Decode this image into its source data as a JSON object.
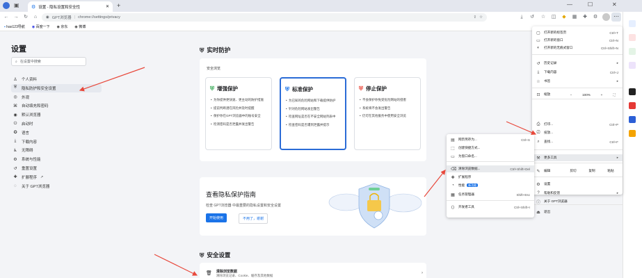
{
  "browser": {
    "tab_title": "设置 - 隐私设置和安全性",
    "new_tab": "+",
    "url_prefix": "GPT浏览器",
    "url": "chrome://settings/privacy",
    "win_min": "—",
    "win_max": "☐",
    "win_close": "✕",
    "bookmarks": [
      "hao123导航",
      "百度一下",
      "京东",
      "微博"
    ]
  },
  "sidebar": {
    "title": "设置",
    "search_placeholder": "在设置中搜索",
    "items": [
      {
        "icon": "person-icon",
        "glyph": "♙",
        "label": "个人资料"
      },
      {
        "icon": "shield-icon",
        "glyph": "⛨",
        "label": "隐私防护和安全设置"
      },
      {
        "icon": "palette-icon",
        "glyph": "◎",
        "label": "外观"
      },
      {
        "icon": "autofill-icon",
        "glyph": "⌘",
        "label": "自动填充和密码"
      },
      {
        "icon": "browser-icon",
        "glyph": "◉",
        "label": "默认浏览器"
      },
      {
        "icon": "power-icon",
        "glyph": "⏻",
        "label": "启动时"
      },
      {
        "icon": "language-icon",
        "glyph": "✪",
        "label": "语言"
      },
      {
        "icon": "download-icon",
        "glyph": "⤓",
        "label": "下载内容"
      },
      {
        "icon": "accessibility-icon",
        "glyph": "♿",
        "label": "无障碍"
      },
      {
        "icon": "system-icon",
        "glyph": "⚙",
        "label": "系统与性能"
      },
      {
        "icon": "reset-icon",
        "glyph": "↺",
        "label": "重置设置"
      },
      {
        "icon": "extension-icon",
        "glyph": "✚",
        "label": "扩展程序"
      },
      {
        "icon": "about-icon",
        "glyph": "◌",
        "label": "关于 GPT浏览器"
      }
    ]
  },
  "safe_browsing": {
    "section_title": "实时防护",
    "subtitle": "安全浏览",
    "options": [
      {
        "title": "增强保护",
        "color": "#34a853",
        "bullets": [
          "为你提供更快速、更主动的防护措施",
          "提前判断潜在风险并及时提醒",
          "保护你在GPT浏览器中的账号安全",
          "检测密码是否泄露并发出警告"
        ]
      },
      {
        "title": "标准保护",
        "color": "#1a73e8",
        "bullets": [
          "为已知的危险网站和下载提供防护",
          "针对危险网站发出警告",
          "检查网址是否在不安全网站列表中",
          "检查密码是否遭到泄露并提示"
        ]
      },
      {
        "title": "停止保护",
        "color": "#ea4335",
        "bullets": [
          "不会保护你免受危险网站的侵害",
          "系统将不会发出警告",
          "仍可在其他服务中使用安全浏览"
        ]
      }
    ]
  },
  "privacy_guide": {
    "title": "查看隐私保护指南",
    "desc": "检查 GPT浏览器 中最重要的隐私设置和安全设置",
    "start": "开始使用",
    "dismiss": "不用了，谢谢"
  },
  "security": {
    "section_title": "安全设置",
    "clear_title": "清除浏览数据",
    "clear_desc": "清除浏览记录、Cookie、缓存及其他数据"
  },
  "main_menu": {
    "items": [
      {
        "icon": "new-tab-icon",
        "glyph": "▢",
        "label": "打开新的标签页",
        "shortcut": "Ctrl+T"
      },
      {
        "icon": "new-window-icon",
        "glyph": "▭",
        "label": "打开新的窗口",
        "shortcut": "Ctrl+N"
      },
      {
        "icon": "incognito-icon",
        "glyph": "◐",
        "label": "打开新的无痕式窗口",
        "shortcut": "Ctrl+Shift+N"
      },
      {
        "icon": "history-icon",
        "glyph": "↺",
        "label": "历史记录",
        "shortcut": "▸"
      },
      {
        "icon": "download-icon",
        "glyph": "⤓",
        "label": "下载内容",
        "shortcut": "Ctrl+J"
      },
      {
        "icon": "bookmark-icon",
        "glyph": "☆",
        "label": "书签",
        "shortcut": "▸"
      },
      {
        "icon": "print-icon",
        "glyph": "⎙",
        "label": "打印...",
        "shortcut": "Ctrl+P"
      },
      {
        "icon": "cast-icon",
        "glyph": "⎚",
        "label": "投放...",
        "shortcut": ""
      },
      {
        "icon": "find-icon",
        "glyph": "⌕",
        "label": "查找...",
        "shortcut": "Ctrl+F"
      },
      {
        "icon": "tools-icon",
        "glyph": "⚒",
        "label": "更多工具",
        "shortcut": "▸"
      },
      {
        "icon": "settings-icon",
        "glyph": "⚙",
        "label": "设置",
        "shortcut": ""
      },
      {
        "icon": "help-icon",
        "glyph": "?",
        "label": "帮助和反馈",
        "shortcut": "▸"
      },
      {
        "icon": "about-icon",
        "glyph": "ⓘ",
        "label": "关于 GPT浏览器",
        "shortcut": ""
      },
      {
        "icon": "exit-icon",
        "glyph": "⏏",
        "label": "退出",
        "shortcut": ""
      }
    ],
    "zoom_label": "缩放",
    "zoom_minus": "−",
    "zoom_value": "100%",
    "zoom_plus": "+",
    "zoom_full": "⛶",
    "edit_label": "编辑",
    "cut": "剪切",
    "copy": "复制",
    "paste": "粘贴"
  },
  "tools_menu": {
    "items": [
      {
        "icon": "save-icon",
        "glyph": "▤",
        "label": "网页另存为...",
        "shortcut": "Ctrl+S"
      },
      {
        "icon": "shortcut-icon",
        "glyph": "⬚",
        "label": "创建快捷方式...",
        "shortcut": ""
      },
      {
        "icon": "name-window-icon",
        "glyph": "▭",
        "label": "为窗口命名...",
        "shortcut": ""
      },
      {
        "icon": "clear-data-icon",
        "glyph": "⌫",
        "label": "清除浏览数据...",
        "shortcut": "Ctrl+Shift+Del"
      },
      {
        "icon": "extensions-icon",
        "glyph": "✚",
        "label": "扩展程序",
        "shortcut": ""
      },
      {
        "icon": "performance-icon",
        "glyph": "◔",
        "label": "性能",
        "shortcut": ""
      },
      {
        "icon": "task-manager-icon",
        "glyph": "▦",
        "label": "任务管理器",
        "shortcut": "Shift+Esc"
      },
      {
        "icon": "devtools-icon",
        "glyph": "⟨⟩",
        "label": "开发者工具",
        "shortcut": "Ctrl+Shift+I"
      }
    ],
    "new_badge": "新功能"
  },
  "colors": {
    "accent": "#1a73e8",
    "arrow": "#e8483b",
    "menu_highlight": "#e8eaed"
  }
}
